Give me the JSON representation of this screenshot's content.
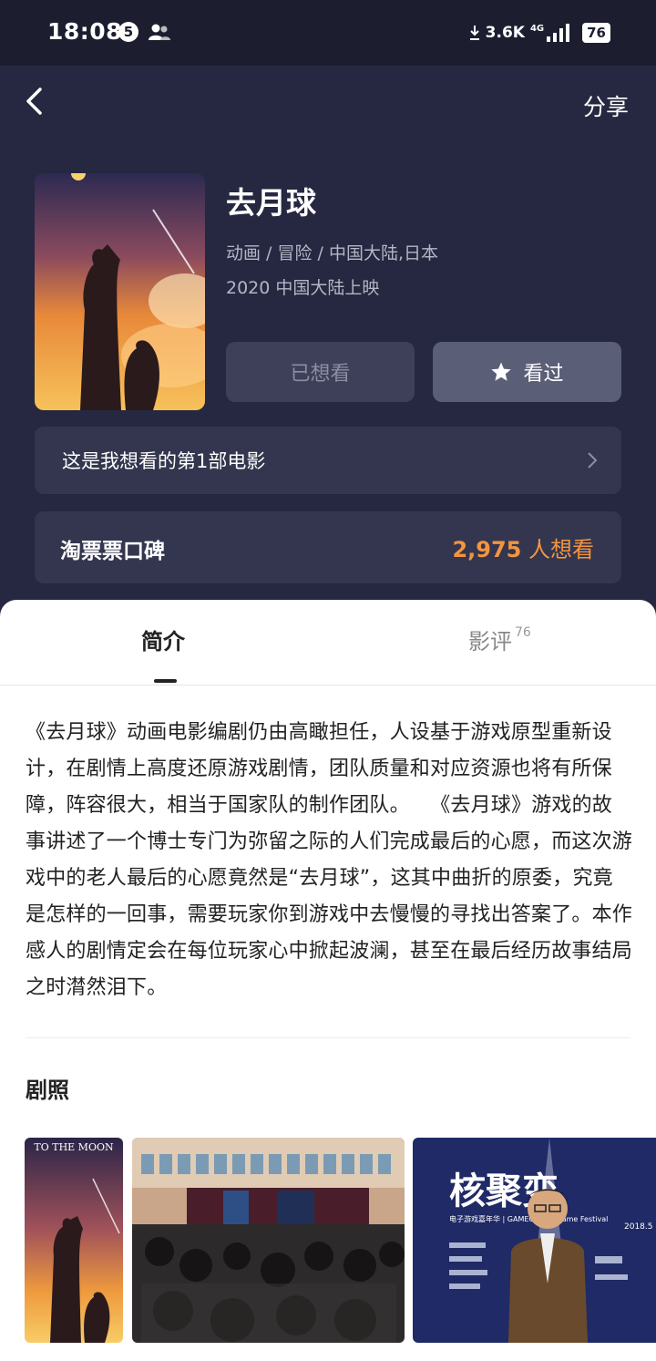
{
  "status_bar": {
    "time": "18:08",
    "notification_count": "5",
    "net_speed": "3.6K",
    "network_type": "4G",
    "battery": "76"
  },
  "nav": {
    "back_icon": "chevron-left-icon",
    "share_label": "分享"
  },
  "movie": {
    "title": "去月球",
    "genres": "动画 / 冒险 / 中国大陆,日本",
    "release": "2020 中国大陆上映",
    "want_button": "已想看",
    "seen_button": "看过",
    "seen_icon": "star-icon",
    "want_note": "这是我想看的第1部电影",
    "rating_label": "淘票票口碑",
    "want_count": "2,975",
    "want_count_suffix": "人想看"
  },
  "tabs": {
    "intro": "简介",
    "reviews": "影评",
    "reviews_count": "76"
  },
  "synopsis": "《去月球》动画电影编剧仍由高瞰担任，人设基于游戏原型重新设计，在剧情上高度还原游戏剧情，团队质量和对应资源也将有所保障，阵容很大，相当于国家队的制作团队。　　《去月球》游戏的故事讲述了一个博士专门为弥留之际的人们完成最后的心愿，而这次游戏中的老人最后的心愿竟然是“去月球”，这其中曲折的原委，究竟是怎样的一回事，需要玩家你到游戏中去慢慢的寻找出答案了。本作感人的剧情定会在每位玩家心中掀起波澜，甚至在最后经历故事结局之时潸然泪下。",
  "stills": {
    "title": "剧照",
    "poster_text": "TO THE MOON",
    "festival_logo": "核聚变",
    "festival_text": "电子游戏嘉年华 | GAMECORES Game Festival",
    "festival_date": "2018.5"
  },
  "colors": {
    "header_bg": "#252840",
    "card_bg": "#33364e",
    "accent_orange": "#f5943f"
  }
}
